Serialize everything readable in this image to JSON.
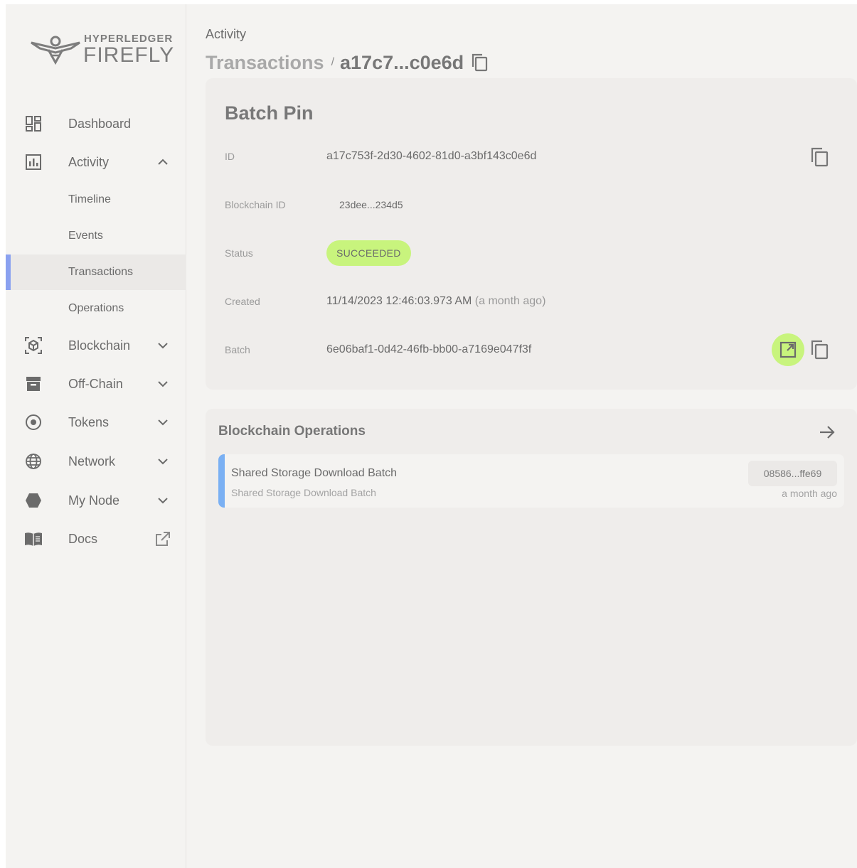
{
  "app": {
    "logo_line1": "HYPERLEDGER",
    "logo_line2": "FIREFLY",
    "accent_color": "#8aa1f0",
    "success_color": "#c8f47d"
  },
  "sidebar": {
    "items": [
      {
        "label": "Dashboard",
        "icon": "dashboard-icon"
      },
      {
        "label": "Activity",
        "icon": "bar-chart-icon",
        "expanded": true
      },
      {
        "label": "Blockchain",
        "icon": "blockchain-icon"
      },
      {
        "label": "Off-Chain",
        "icon": "archive-icon"
      },
      {
        "label": "Tokens",
        "icon": "token-icon"
      },
      {
        "label": "Network",
        "icon": "globe-icon"
      },
      {
        "label": "My Node",
        "icon": "hexagon-icon"
      },
      {
        "label": "Docs",
        "icon": "book-icon"
      }
    ],
    "activity_sub": [
      {
        "label": "Timeline"
      },
      {
        "label": "Events"
      },
      {
        "label": "Transactions",
        "active": true
      },
      {
        "label": "Operations"
      }
    ]
  },
  "header": {
    "section": "Activity",
    "breadcrumb_link": "Transactions",
    "separator": "/",
    "current": "a17c7...c0e6d"
  },
  "details": {
    "title": "Batch Pin",
    "fields": {
      "id_label": "ID",
      "id_value": "a17c753f-2d30-4602-81d0-a3bf143c0e6d",
      "blockchain_id_label": "Blockchain ID",
      "blockchain_id_value": "23dee...234d5",
      "status_label": "Status",
      "status_value": "SUCCEEDED",
      "created_label": "Created",
      "created_value": "11/14/2023 12:46:03.973 AM",
      "created_relative": "(a month ago)",
      "batch_label": "Batch",
      "batch_value": "6e06baf1-0d42-46fb-bb00-a7169e047f3f"
    }
  },
  "operations": {
    "title": "Blockchain Operations",
    "items": [
      {
        "title": "Shared Storage Download Batch",
        "subtitle": "Shared Storage Download Batch",
        "id_chip": "08586...ffe69",
        "time": "a month ago"
      }
    ]
  }
}
